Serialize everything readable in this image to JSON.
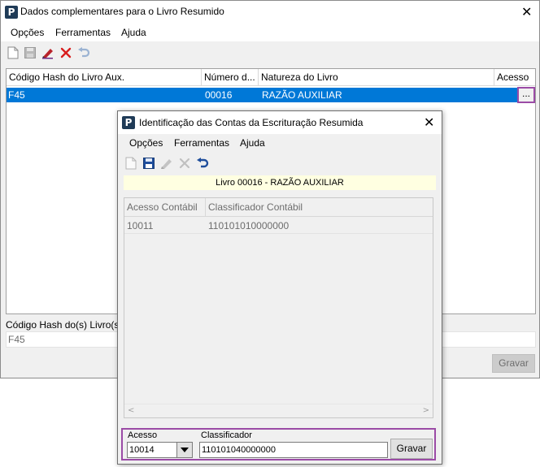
{
  "main_window": {
    "title": "Dados complementares para o Livro Resumido",
    "app_icon_letter": "P",
    "close_glyph": "✕",
    "menu": [
      "Opções",
      "Ferramentas",
      "Ajuda"
    ],
    "toolbar_icons": [
      "new-document-icon",
      "save-icon",
      "edit-icon",
      "delete-icon",
      "undo-icon"
    ],
    "grid": {
      "columns": [
        "Código Hash do Livro Aux.",
        "Número d...",
        "Natureza do Livro",
        "Acesso"
      ],
      "rows": [
        {
          "hash": "F45",
          "numero": "00016",
          "natureza": "RAZÃO AUXILIAR",
          "acesso_button": "..."
        }
      ]
    },
    "hash_label": "Código Hash do(s) Livro(s) Au",
    "hash_value": "F45",
    "gravar_label": "Gravar"
  },
  "dialog": {
    "title": "Identificação das Contas da Escrituração Resumida",
    "app_icon_letter": "P",
    "close_glyph": "✕",
    "menu": [
      "Opções",
      "Ferramentas",
      "Ajuda"
    ],
    "toolbar_icons": [
      "new-document-icon",
      "save-icon",
      "edit-icon",
      "delete-icon",
      "undo-icon"
    ],
    "livro_banner": "Livro 00016 - RAZÃO AUXILIAR",
    "grid": {
      "columns": [
        "Acesso Contábil",
        "Classificador Contábil"
      ],
      "rows": [
        {
          "acesso": "10011",
          "classificador": "110101010000000"
        }
      ]
    },
    "edit": {
      "acesso_label": "Acesso",
      "acesso_value": "10014",
      "classificador_label": "Classificador",
      "classificador_value": "110101040000000",
      "gravar_label": "Gravar"
    }
  },
  "colors": {
    "selection": "#0078d7",
    "highlight_border": "#9b4ba6",
    "banner": "#ffffe1",
    "app_icon": "#1f3b57"
  }
}
